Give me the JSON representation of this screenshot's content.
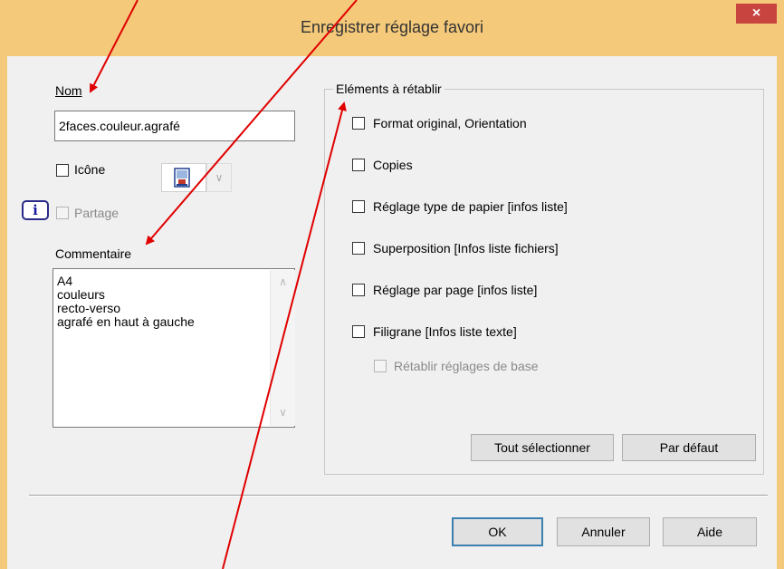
{
  "title": "Enregistrer réglage favori",
  "close_glyph": "×",
  "nom": {
    "label": "Nom",
    "value": "2faces.couleur.agrafé"
  },
  "icone": {
    "label": "Icône",
    "dropdown_glyph": "∨"
  },
  "partage": {
    "label": "Partage",
    "info_glyph": "i"
  },
  "commentaire": {
    "label": "Commentaire",
    "lines": [
      "A4",
      "couleurs",
      "recto-verso",
      "agrafé en haut à gauche"
    ],
    "scroll_up": "∧",
    "scroll_down": "∨"
  },
  "elements": {
    "title": "Eléments à rétablir",
    "items": [
      "Format original, Orientation",
      "Copies",
      "Réglage type de papier [infos liste]",
      "Superposition [Infos liste fichiers]",
      "Réglage par page [infos liste]",
      "Filigrane [Infos liste texte]"
    ],
    "subitem": "Rétablir réglages de base",
    "select_all": "Tout sélectionner",
    "default": "Par défaut"
  },
  "buttons": {
    "ok": "OK",
    "cancel": "Annuler",
    "help": "Aide"
  },
  "colors": {
    "frame": "#f4c97a",
    "close": "#c7443f",
    "annotation_arrow": "#e00000",
    "info_icon": "#1a1aa0"
  }
}
